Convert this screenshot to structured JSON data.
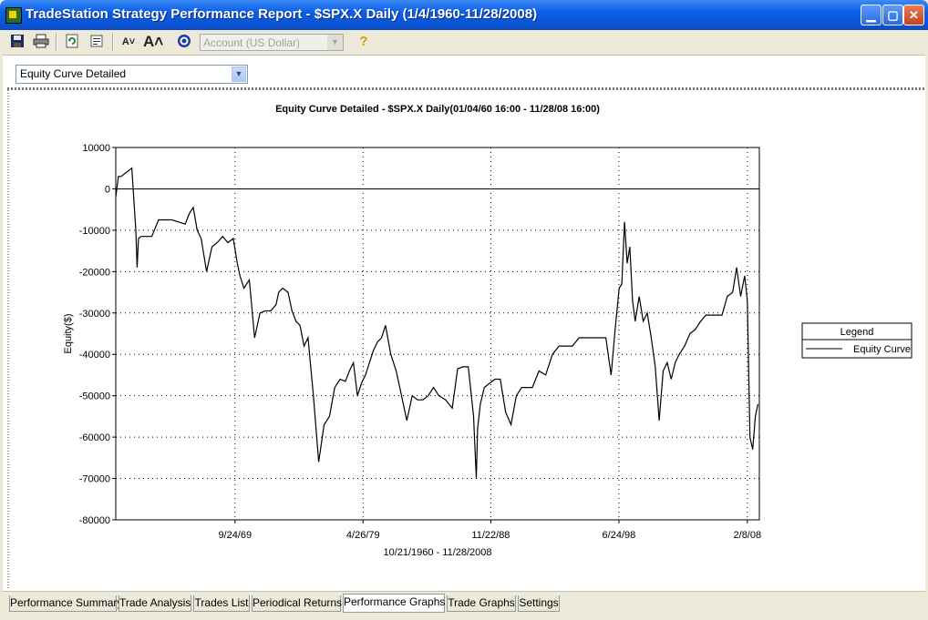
{
  "window": {
    "title": "TradeStation Strategy Performance Report - $SPX.X Daily (1/4/1960-11/28/2008)"
  },
  "toolbar": {
    "account_value": "Account (US Dollar)"
  },
  "chart_selector": {
    "value": "Equity Curve Detailed"
  },
  "legend": {
    "title": "Legend"
  },
  "tabs": [
    {
      "label": "Performance Summary",
      "active": false
    },
    {
      "label": "Trade Analysis",
      "active": false
    },
    {
      "label": "Trades List",
      "active": false
    },
    {
      "label": "Periodical Returns",
      "active": false
    },
    {
      "label": "Performance Graphs",
      "active": true
    },
    {
      "label": "Trade Graphs",
      "active": false
    },
    {
      "label": "Settings",
      "active": false
    }
  ],
  "chart_data": {
    "type": "line",
    "title": "Equity Curve Detailed - $SPX.X Daily(01/04/60 16:00 - 11/28/08 16:00)",
    "xlabel": "10/21/1960 - 11/28/2008",
    "ylabel": "Equity($)",
    "ylim": [
      -80000,
      10000
    ],
    "yticks": [
      10000,
      0,
      -10000,
      -20000,
      -30000,
      -40000,
      -50000,
      -60000,
      -70000,
      -80000
    ],
    "xlim": [
      1960.8,
      2009.0
    ],
    "xticks": [
      {
        "x": 1969.73,
        "label": "9/24/69"
      },
      {
        "x": 1979.32,
        "label": "4/26/79"
      },
      {
        "x": 1988.89,
        "label": "11/22/88"
      },
      {
        "x": 1998.48,
        "label": "6/24/98"
      },
      {
        "x": 2008.1,
        "label": "2/8/08"
      }
    ],
    "grid": true,
    "legend": "right",
    "series": [
      {
        "name": "Equity Curve",
        "color": "#000000",
        "x": [
          1960.8,
          1961.0,
          1961.2,
          1962.0,
          1962.3,
          1962.4,
          1962.5,
          1962.7,
          1962.9,
          1963.2,
          1963.5,
          1964.0,
          1964.5,
          1965.0,
          1965.5,
          1966.0,
          1966.3,
          1966.6,
          1966.9,
          1967.2,
          1967.6,
          1968.0,
          1968.4,
          1968.8,
          1969.2,
          1969.6,
          1969.9,
          1970.1,
          1970.4,
          1970.8,
          1971.2,
          1971.6,
          1972.0,
          1972.4,
          1972.8,
          1973.0,
          1973.3,
          1973.7,
          1974.0,
          1974.3,
          1974.6,
          1974.9,
          1975.2,
          1975.6,
          1976.0,
          1976.4,
          1976.8,
          1977.2,
          1977.6,
          1978.0,
          1978.3,
          1978.6,
          1978.9,
          1979.2,
          1979.5,
          1979.8,
          1980.1,
          1980.4,
          1980.7,
          1981.0,
          1981.4,
          1981.8,
          1982.2,
          1982.6,
          1983.0,
          1983.4,
          1983.8,
          1984.2,
          1984.6,
          1985.0,
          1985.5,
          1986.0,
          1986.4,
          1986.8,
          1987.2,
          1987.6,
          1987.8,
          1987.9,
          1988.1,
          1988.4,
          1988.8,
          1989.2,
          1989.6,
          1990.0,
          1990.4,
          1990.8,
          1991.2,
          1991.6,
          1992.0,
          1992.5,
          1993.0,
          1993.5,
          1994.0,
          1994.5,
          1995.0,
          1995.5,
          1996.0,
          1996.5,
          1997.0,
          1997.5,
          1997.9,
          1998.2,
          1998.5,
          1998.7,
          1998.9,
          1999.1,
          1999.3,
          1999.5,
          1999.7,
          2000.0,
          2000.3,
          2000.6,
          2000.9,
          2001.2,
          2001.5,
          2001.8,
          2002.1,
          2002.4,
          2002.7,
          2003.0,
          2003.4,
          2003.8,
          2004.2,
          2004.6,
          2005.0,
          2005.4,
          2005.8,
          2006.2,
          2006.6,
          2007.0,
          2007.3,
          2007.6,
          2007.9,
          2008.1,
          2008.3,
          2008.5,
          2008.7,
          2008.9
        ],
        "y": [
          -2000,
          3000,
          3000,
          5000,
          -10000,
          -19000,
          -12000,
          -11500,
          -11500,
          -11500,
          -11500,
          -7500,
          -7500,
          -7500,
          -8000,
          -8500,
          -6000,
          -4500,
          -10000,
          -12000,
          -20000,
          -14000,
          -13000,
          -11500,
          -13000,
          -12000,
          -18000,
          -21000,
          -24000,
          -22000,
          -36000,
          -30000,
          -29500,
          -29500,
          -28000,
          -25000,
          -24000,
          -25000,
          -29500,
          -32000,
          -33000,
          -38000,
          -36000,
          -50000,
          -66000,
          -57000,
          -55000,
          -48000,
          -46000,
          -46500,
          -44000,
          -42000,
          -50000,
          -47000,
          -45000,
          -42000,
          -39000,
          -37000,
          -36000,
          -33000,
          -40000,
          -44000,
          -50000,
          -56000,
          -50000,
          -51000,
          -51000,
          -50000,
          -48000,
          -50000,
          -51000,
          -53000,
          -43500,
          -43000,
          -43000,
          -55000,
          -70000,
          -58000,
          -52000,
          -48000,
          -47000,
          -46000,
          -46000,
          -54000,
          -57000,
          -50000,
          -48000,
          -48000,
          -48000,
          -44000,
          -45000,
          -40000,
          -38000,
          -38000,
          -38000,
          -36000,
          -36000,
          -36000,
          -36000,
          -36000,
          -45000,
          -34000,
          -24000,
          -23000,
          -8000,
          -18000,
          -14000,
          -27000,
          -32000,
          -26000,
          -32000,
          -30000,
          -36000,
          -43000,
          -56000,
          -44000,
          -42000,
          -46000,
          -42000,
          -40000,
          -38000,
          -35000,
          -34000,
          -32000,
          -30500,
          -30500,
          -30500,
          -30500,
          -26000,
          -25000,
          -19000,
          -26000,
          -21000,
          -27000,
          -60000,
          -63000,
          -55000,
          -52000
        ]
      }
    ]
  }
}
